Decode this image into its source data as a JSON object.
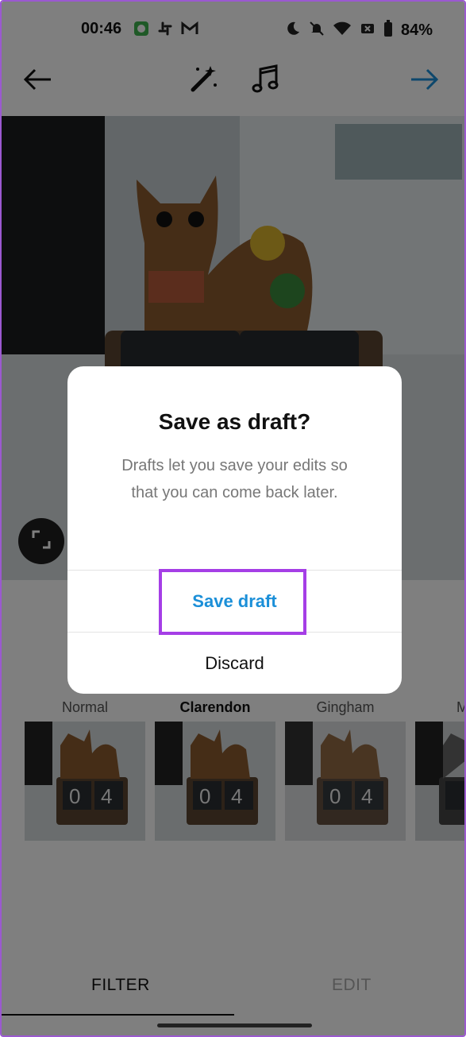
{
  "status_bar": {
    "time": "00:46",
    "battery": "84%"
  },
  "toolbar": {
    "back_icon": "arrow-left-icon",
    "magic_icon": "magic-wand-icon",
    "music_icon": "music-note-icon",
    "next_icon": "arrow-right-icon",
    "accent": "#1b8fd8"
  },
  "filters": [
    {
      "name": "Normal"
    },
    {
      "name": "Clarendon",
      "active": true
    },
    {
      "name": "Gingham"
    },
    {
      "name": "M"
    }
  ],
  "tabs": {
    "filter": "FILTER",
    "edit": "EDIT"
  },
  "dialog": {
    "title": "Save as draft?",
    "body": "Drafts let you save your edits so that you can come back later.",
    "save_label": "Save draft",
    "discard_label": "Discard",
    "save_color": "#1b8fd8",
    "highlight_color": "#a53ee6"
  }
}
